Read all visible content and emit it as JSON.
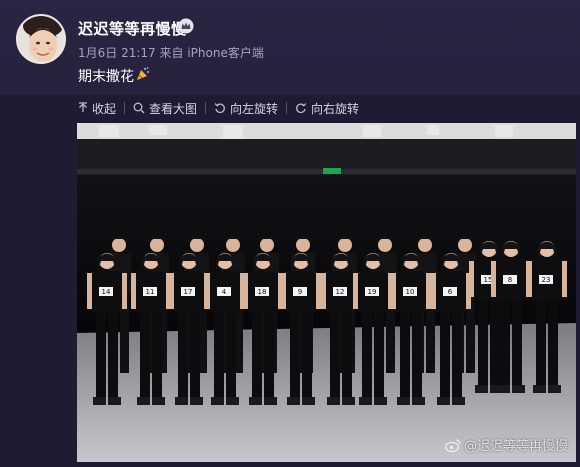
{
  "post": {
    "username": "迟迟等等再慢慢",
    "date": "1月6日 21:17",
    "from_label": "来自",
    "source": "iPhone客户端",
    "text": "期末撒花"
  },
  "toolbar": {
    "collapse": "收起",
    "view_large": "查看大图",
    "rotate_left": "向左旋转",
    "rotate_right": "向右旋转"
  },
  "photo": {
    "watermark": "@迟迟等等再慢慢",
    "name_tags": [
      "14",
      "11",
      "17",
      "4",
      "18",
      "9",
      "12",
      "19",
      "10",
      "6",
      "15",
      "8",
      "23"
    ]
  },
  "colors": {
    "background": "#1f1b33",
    "card": "#2a2542",
    "meta_text": "#a8a3bd",
    "toolbar_text": "#d8d4e6"
  }
}
